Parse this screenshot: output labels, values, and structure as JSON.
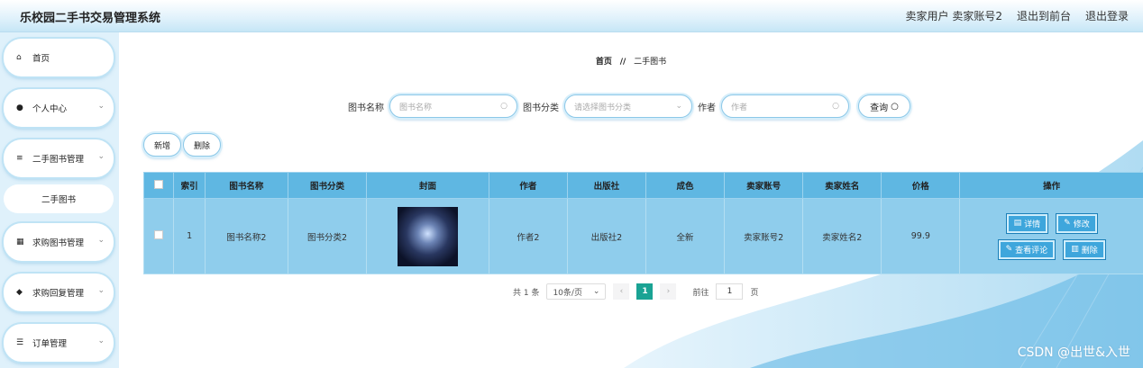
{
  "app": {
    "title": "乐校园二手书交易管理系统"
  },
  "topbar": {
    "user": "卖家用户 卖家账号2",
    "front": "退出到前台",
    "logout": "退出登录"
  },
  "sidebar": {
    "items": [
      {
        "label": "首页",
        "icon": "home-icon"
      },
      {
        "label": "个人中心",
        "icon": "user-icon"
      },
      {
        "label": "二手图书管理",
        "icon": "sliders-icon"
      },
      {
        "label": "求购图书管理",
        "icon": "grid-icon"
      },
      {
        "label": "求购回复管理",
        "icon": "pin-icon"
      },
      {
        "label": "订单管理",
        "icon": "list-icon"
      }
    ],
    "sub": "二手图书"
  },
  "breadcrumb": {
    "home": "首页",
    "sep": "//",
    "current": "二手图书"
  },
  "search": {
    "name_label": "图书名称",
    "name_placeholder": "图书名称",
    "cat_label": "图书分类",
    "cat_placeholder": "请选择图书分类",
    "author_label": "作者",
    "author_placeholder": "作者",
    "query": "查询"
  },
  "toolbar": {
    "add": "新增",
    "delete": "删除"
  },
  "table": {
    "headers": [
      "索引",
      "图书名称",
      "图书分类",
      "封面",
      "作者",
      "出版社",
      "成色",
      "卖家账号",
      "卖家姓名",
      "价格",
      "操作"
    ],
    "rows": [
      {
        "index": "1",
        "name": "图书名称2",
        "cat": "图书分类2",
        "author": "作者2",
        "publisher": "出版社2",
        "condition": "全新",
        "seller_account": "卖家账号2",
        "seller_name": "卖家姓名2",
        "price": "99.9"
      }
    ],
    "actions": {
      "detail": "详情",
      "edit": "修改",
      "reviews": "查看评论",
      "delete": "删除"
    }
  },
  "pager": {
    "total": "共 1 条",
    "size": "10条/页",
    "page": "1",
    "goto": "前往",
    "goto_value": "1",
    "page_unit": "页"
  },
  "watermark": "CSDN @出世&入世",
  "colors": {
    "header": "#5fb7e2",
    "row": "#8fcdec",
    "accent": "#1aa394"
  }
}
